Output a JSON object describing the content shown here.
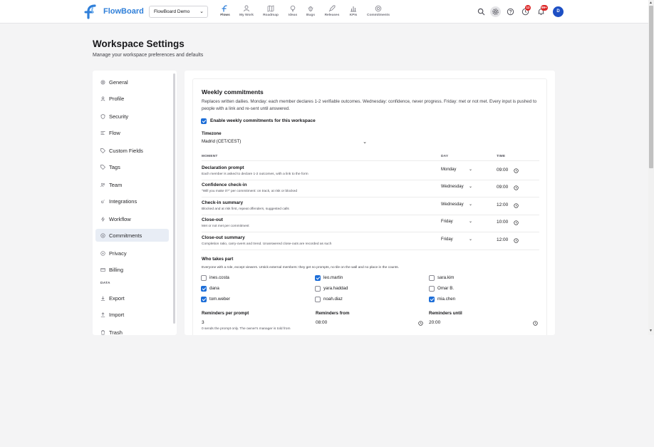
{
  "app": {
    "name": "FlowBoard",
    "workspace_select": "FlowBoard Demo"
  },
  "nav": [
    {
      "label": "Flows",
      "icon": "flows-icon",
      "active": true
    },
    {
      "label": "My Work",
      "icon": "person-icon"
    },
    {
      "label": "Roadmap",
      "icon": "map-icon"
    },
    {
      "label": "Ideas",
      "icon": "lightbulb-icon"
    },
    {
      "label": "Bugs",
      "icon": "bug-icon"
    },
    {
      "label": "Releases",
      "icon": "rocket-icon"
    },
    {
      "label": "KPIs",
      "icon": "bar-chart-icon"
    },
    {
      "label": "Commitments",
      "icon": "target-icon"
    }
  ],
  "toolbar": {
    "badge_help": "12",
    "badge_notifications": "99+",
    "avatar": "D"
  },
  "page": {
    "title": "Workspace Settings",
    "subtitle": "Manage your workspace preferences and defaults"
  },
  "sidebar": {
    "items": [
      {
        "label": "General",
        "icon": "gear-icon"
      },
      {
        "label": "Profile",
        "icon": "person-icon"
      },
      {
        "label": "Security",
        "icon": "shield-icon"
      },
      {
        "label": "Flow",
        "icon": "flow-lines-icon"
      },
      {
        "label": "Custom Fields",
        "icon": "tag-icon"
      },
      {
        "label": "Tags",
        "icon": "tag-icon"
      },
      {
        "label": "Team",
        "icon": "team-icon"
      },
      {
        "label": "Integrations",
        "icon": "link-icon"
      },
      {
        "label": "Workflow",
        "icon": "lightning-icon"
      },
      {
        "label": "Commitments",
        "icon": "target-icon",
        "active": true
      },
      {
        "label": "Privacy",
        "icon": "eye-icon"
      },
      {
        "label": "Billing",
        "icon": "credit-card-icon"
      }
    ],
    "data_group": "DATA",
    "data_items": [
      {
        "label": "Export",
        "icon": "download-icon"
      },
      {
        "label": "Import",
        "icon": "upload-icon"
      },
      {
        "label": "Trash",
        "icon": "trash-icon"
      }
    ]
  },
  "commitments": {
    "title": "Weekly commitments",
    "description": "Replaces written dailies. Monday: each member declares 1-2 verifiable outcomes. Wednesday: confidence, never progress. Friday: met or not met. Every input is pushed to people with a link and re-sent until answered.",
    "enable_label": "Enable weekly commitments for this workspace",
    "enabled": true,
    "timezone_label": "Timezone",
    "timezone": "Madrid (CET/CEST)",
    "columns": {
      "moment": "MOMENT",
      "day": "DAY",
      "time": "TIME"
    },
    "moments": [
      {
        "title": "Declaration prompt",
        "desc": "Each member is asked to declare 1-2 outcomes, with a link to the form",
        "day": "Monday",
        "time": "09:00"
      },
      {
        "title": "Confidence check-in",
        "desc": "\"Will you make it?\" per commitment: on track, at risk or blocked",
        "day": "Wednesday",
        "time": "09:00"
      },
      {
        "title": "Check-in summary",
        "desc": "Blocked and at risk first, repeat offenders, suggested calls",
        "day": "Wednesday",
        "time": "12:00"
      },
      {
        "title": "Close-out",
        "desc": "Met or not met per commitment",
        "day": "Friday",
        "time": "10:00"
      },
      {
        "title": "Close-out summary",
        "desc": "Completion ratio, carry-overs and trend. Unanswered close-outs are recorded as such",
        "day": "Friday",
        "time": "12:00"
      }
    ],
    "who_title": "Who takes part",
    "who_desc": "Everyone with a role, except viewers. Untick external members: they get no prompts, no tile on the wall and no place in the counts.",
    "members": [
      {
        "name": "ines.costa",
        "checked": false
      },
      {
        "name": "leo.martin",
        "checked": true
      },
      {
        "name": "sara.kim",
        "checked": false
      },
      {
        "name": "dana",
        "checked": true
      },
      {
        "name": "yara.haddad",
        "checked": false
      },
      {
        "name": "Omar B.",
        "checked": false
      },
      {
        "name": "tom.weber",
        "checked": true
      },
      {
        "name": "noah.diaz",
        "checked": false
      },
      {
        "name": "mia.chen",
        "checked": true
      }
    ],
    "reminders": {
      "per_prompt_label": "Reminders per prompt",
      "per_prompt_value": "3",
      "from_label": "Reminders from",
      "from_value": "08:00",
      "until_label": "Reminders until",
      "until_value": "20:00",
      "hint": "0 sends the prompt only. The owner's manager is told from"
    }
  }
}
